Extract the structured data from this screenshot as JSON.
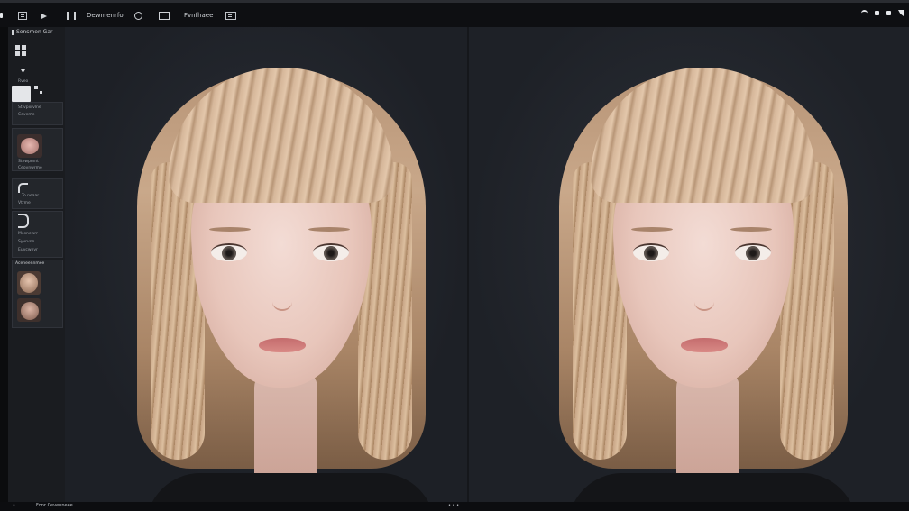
{
  "toolbar": {
    "project_label": "Dewmenrfo",
    "file_label": "Fvnfhaee"
  },
  "left_panel": {
    "title": "Sensmen  Gar",
    "group1": [
      "Rveo",
      "St vpxrvlne",
      "Ceveme"
    ],
    "group2": [
      "Stewpmnt",
      "Ceovnwrme"
    ],
    "group3": [
      "To neaar",
      "Vtrme"
    ],
    "group4": [
      "Mesnewrr",
      "Syvrvnn",
      "Euvcwnvr"
    ],
    "group5_title": "Aceneennmee"
  },
  "status": {
    "left_text": "Fonr   Ceveuneee",
    "center_text": "• • •"
  },
  "colors": {
    "background": "#202329",
    "toolbar": "#0e0f12",
    "panel": "#1a1c20"
  }
}
